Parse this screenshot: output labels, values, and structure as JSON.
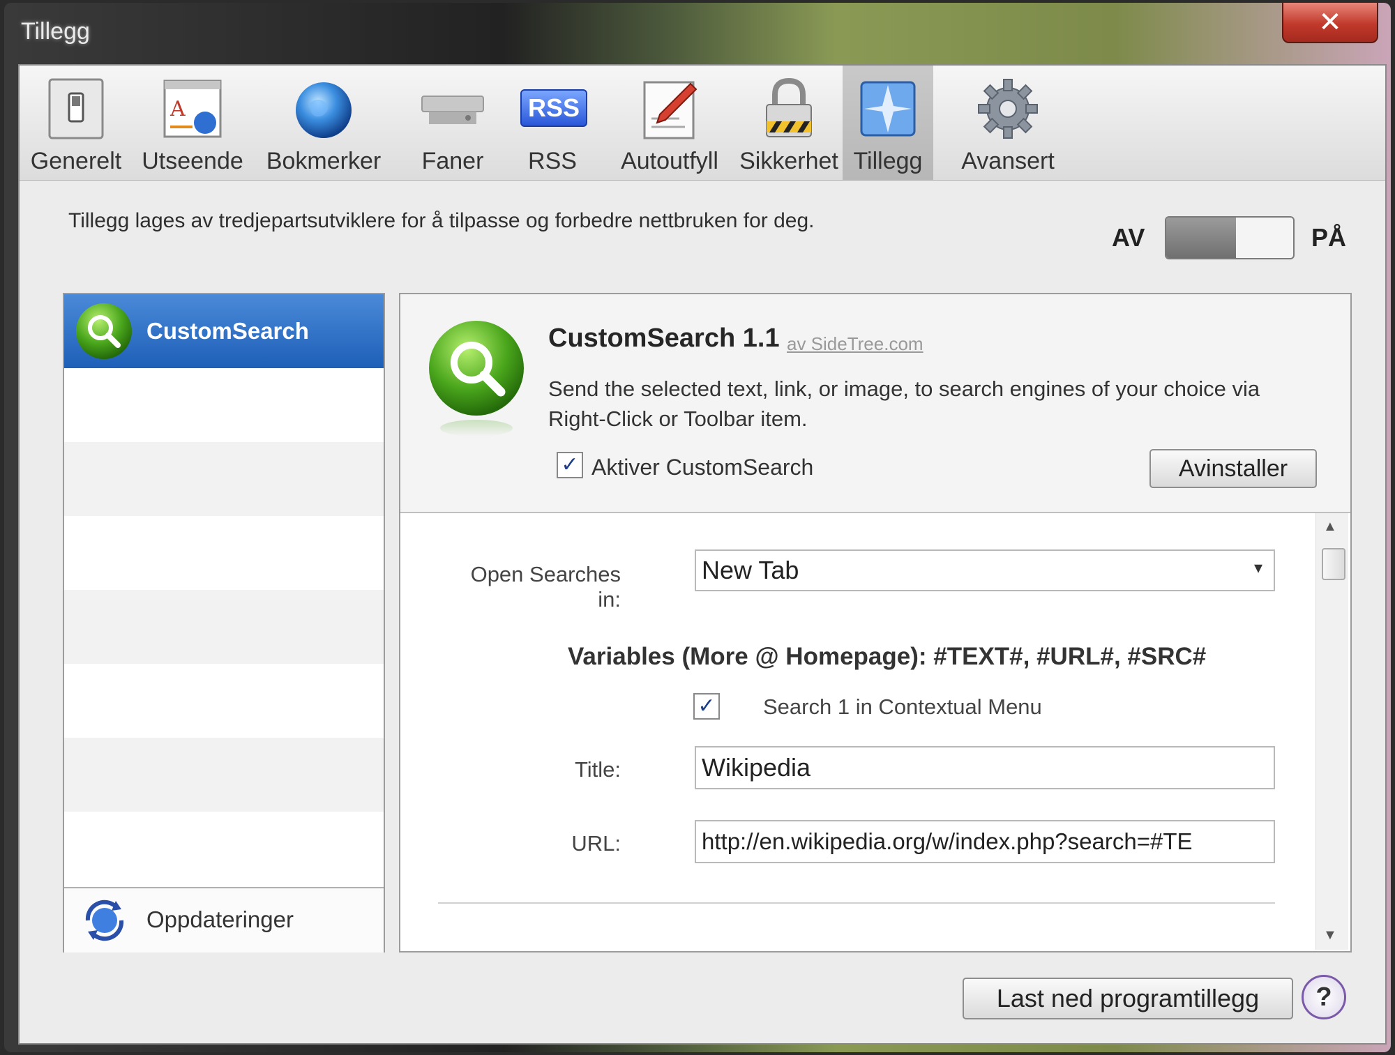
{
  "window": {
    "title": "Tillegg",
    "close_glyph": "✕"
  },
  "toolbar": {
    "items": [
      {
        "label": "Generelt",
        "icon": "switch-icon"
      },
      {
        "label": "Utseende",
        "icon": "appearance-icon"
      },
      {
        "label": "Bokmerker",
        "icon": "globe-icon"
      },
      {
        "label": "Faner",
        "icon": "tabs-icon"
      },
      {
        "label": "RSS",
        "icon": "rss-icon",
        "badge": "RSS"
      },
      {
        "label": "Autoutfyll",
        "icon": "pencil-icon"
      },
      {
        "label": "Sikkerhet",
        "icon": "lock-icon"
      },
      {
        "label": "Tillegg",
        "icon": "extension-compass-icon",
        "selected": true
      },
      {
        "label": "Avansert",
        "icon": "gear-icon"
      }
    ]
  },
  "intro_text": "Tillegg lages av tredjepartsutviklere for å tilpasse og forbedre nettbruken for deg.",
  "toggle": {
    "off_label": "AV",
    "on_label": "PÅ",
    "state": "AV"
  },
  "sidebar": {
    "selected_item": "CustomSearch",
    "footer_label": "Oppdateringer"
  },
  "extension": {
    "title": "CustomSearch 1.1",
    "author": "av SideTree.com",
    "description": "Send the selected text, link, or image, to search engines of your choice via Right-Click or Toolbar item.",
    "enable_label": "Aktiver CustomSearch",
    "enabled": true,
    "uninstall_label": "Avinstaller"
  },
  "settings": {
    "open_searches_label": "Open Searches in:",
    "open_searches_value": "New Tab",
    "variables_heading": "Variables (More @ Homepage): #TEXT#, #URL#, #SRC#",
    "search1_label": "Search 1 in Contextual Menu",
    "search1_checked": true,
    "title_label": "Title:",
    "title_value": "Wikipedia",
    "url_label": "URL:",
    "url_value": "http://en.wikipedia.org/w/index.php?search=#TE"
  },
  "bottom": {
    "download_label": "Last ned programtillegg",
    "help_glyph": "?"
  },
  "colors": {
    "selection_blue": "#2a6cc4",
    "search_green": "#4aa61c"
  }
}
